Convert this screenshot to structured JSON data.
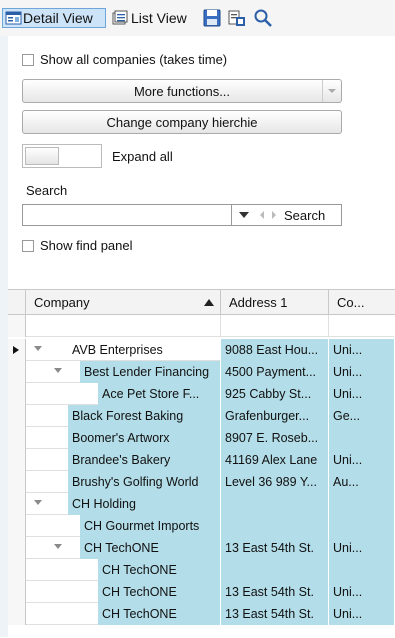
{
  "toolbar": {
    "detail_view": "Detail View",
    "list_view": "List View"
  },
  "panel": {
    "show_all_companies": "Show all companies (takes time)",
    "more_functions": "More functions...",
    "change_hierarchy": "Change company hierchie",
    "expand_all": "Expand all",
    "search_label": "Search",
    "search_button": "Search",
    "show_find_panel": "Show find panel"
  },
  "grid": {
    "columns": [
      "Company",
      "Address 1",
      "Co..."
    ],
    "rows": [
      {
        "company": "AVB Enterprises",
        "address": "9088 East Hou...",
        "country": "Uni..."
      },
      {
        "company": "Best Lender Financing",
        "address": "4500 Payment...",
        "country": "Uni..."
      },
      {
        "company": "Ace Pet Store F...",
        "address": "925 Cabby St...",
        "country": "Uni..."
      },
      {
        "company": "Black Forest Baking",
        "address": "Grafenburger...",
        "country": "Ge..."
      },
      {
        "company": "Boomer's Artworx",
        "address": "8907 E. Roseb...",
        "country": ""
      },
      {
        "company": "Brandee's Bakery",
        "address": "41169 Alex Lane",
        "country": "Uni..."
      },
      {
        "company": "Brushy's Golfing World",
        "address": "Level 36 989 Y...",
        "country": "Au..."
      },
      {
        "company": "CH Holding",
        "address": "",
        "country": ""
      },
      {
        "company": "CH Gourmet Imports",
        "address": "",
        "country": ""
      },
      {
        "company": "CH TechONE",
        "address": "13 East 54th St.",
        "country": "Uni..."
      },
      {
        "company": "CH TechONE",
        "address": "",
        "country": ""
      },
      {
        "company": "CH TechONE",
        "address": "13 East 54th St.",
        "country": "Uni..."
      },
      {
        "company": "CH TechONE",
        "address": "13 East 54th St.",
        "country": "Uni..."
      }
    ]
  },
  "colors": {
    "selection": "#b3dde8",
    "header": "#f3f3f3",
    "active_tab": "#cde3f7"
  },
  "icons": {
    "detail_view": "detail-view-icon",
    "list_view": "list-view-icon",
    "save": "save-icon",
    "export": "export-icon",
    "search": "search-icon",
    "sort_asc": "sort-ascending-icon",
    "dropdown": "chevron-down-icon",
    "expander": "tree-expander-icon",
    "row_pointer": "current-row-icon"
  }
}
